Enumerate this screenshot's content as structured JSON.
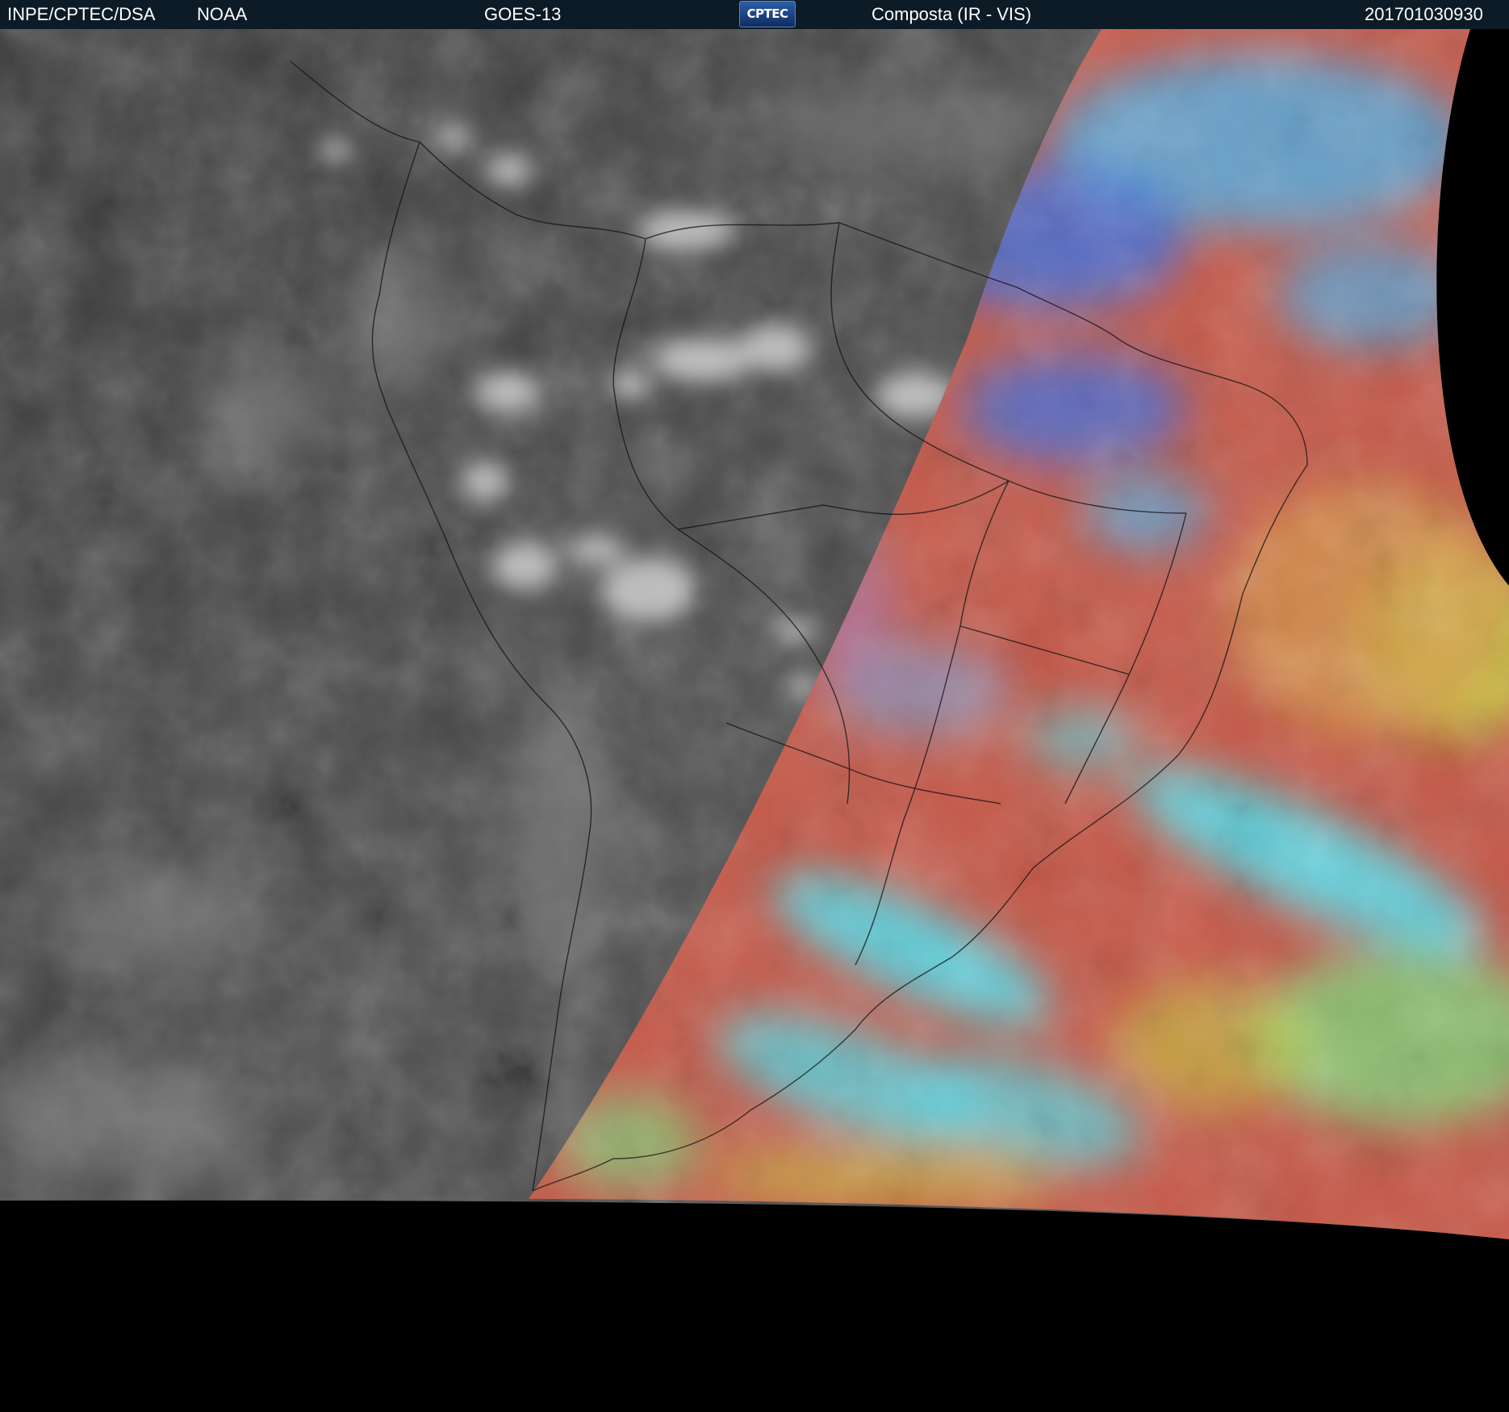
{
  "header": {
    "source": "INPE/CPTEC/DSA",
    "agency": "NOAA",
    "satellite": "GOES-13",
    "logo_text": "CPTEC",
    "product": "Composta (IR - VIS)",
    "timestamp": "201701030930"
  },
  "colors": {
    "header_background": "#0d1b26",
    "background": "#000000",
    "ir_gray": "#4a4a4a",
    "vis_red": "#c65a4a",
    "vis_cyan": "#4fe4f4",
    "vis_blue": "#3f6fe0",
    "vis_yellow": "#c8d63e",
    "vis_green": "#7fd67a"
  }
}
